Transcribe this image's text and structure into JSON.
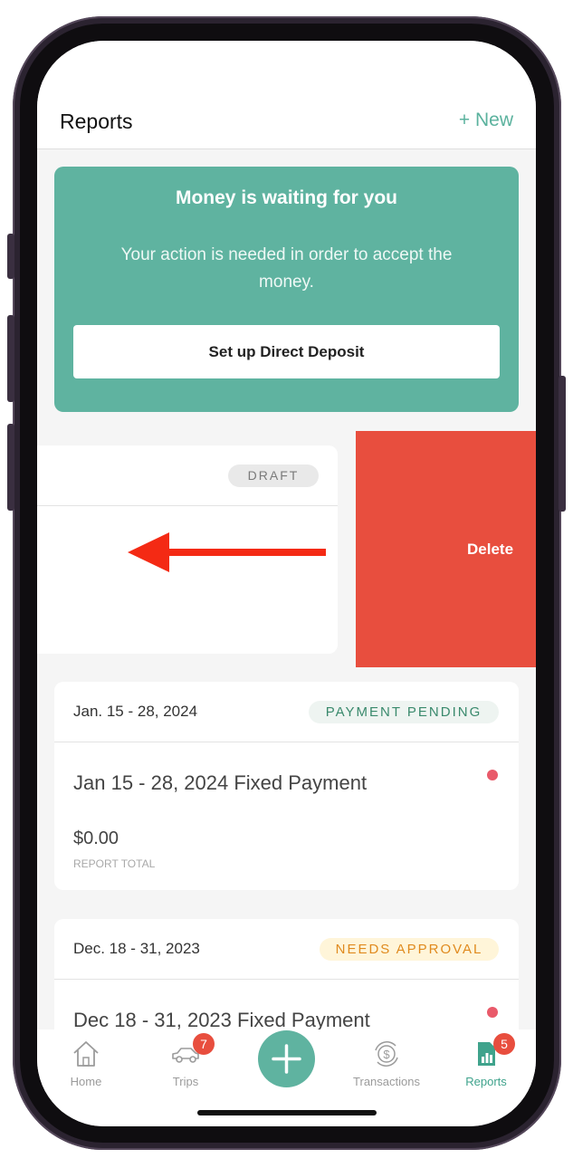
{
  "header": {
    "title": "Reports",
    "new_label": "+ New"
  },
  "promo": {
    "title": "Money is waiting for you",
    "text": "Your action is needed in order to accept the money.",
    "button_label": "Set up Direct Deposit"
  },
  "swiped_card": {
    "status": "DRAFT",
    "delete_label": "Delete"
  },
  "reports": [
    {
      "date_range": "Jan. 15 - 28, 2024",
      "status": "PAYMENT PENDING",
      "title": "Jan 15 - 28, 2024 Fixed Payment",
      "amount": "$0.00",
      "amount_label": "REPORT TOTAL"
    },
    {
      "date_range": "Dec. 18 - 31, 2023",
      "status": "NEEDS APPROVAL",
      "title": "Dec 18 - 31, 2023 Fixed Payment"
    }
  ],
  "tabbar": {
    "tabs": [
      {
        "label": "Home",
        "icon": "home-icon"
      },
      {
        "label": "Trips",
        "icon": "car-icon",
        "badge": "7"
      },
      {
        "label": "Transactions",
        "icon": "dollar-exchange-icon"
      },
      {
        "label": "Reports",
        "icon": "reports-icon",
        "badge": "5"
      }
    ],
    "fab_icon": "plus-icon"
  },
  "colors": {
    "accent": "#5fb3a0",
    "delete": "#e84e3e",
    "badge": "#e84e3e",
    "pending_text": "#3a8a6d",
    "approval_text": "#e08a1e"
  }
}
